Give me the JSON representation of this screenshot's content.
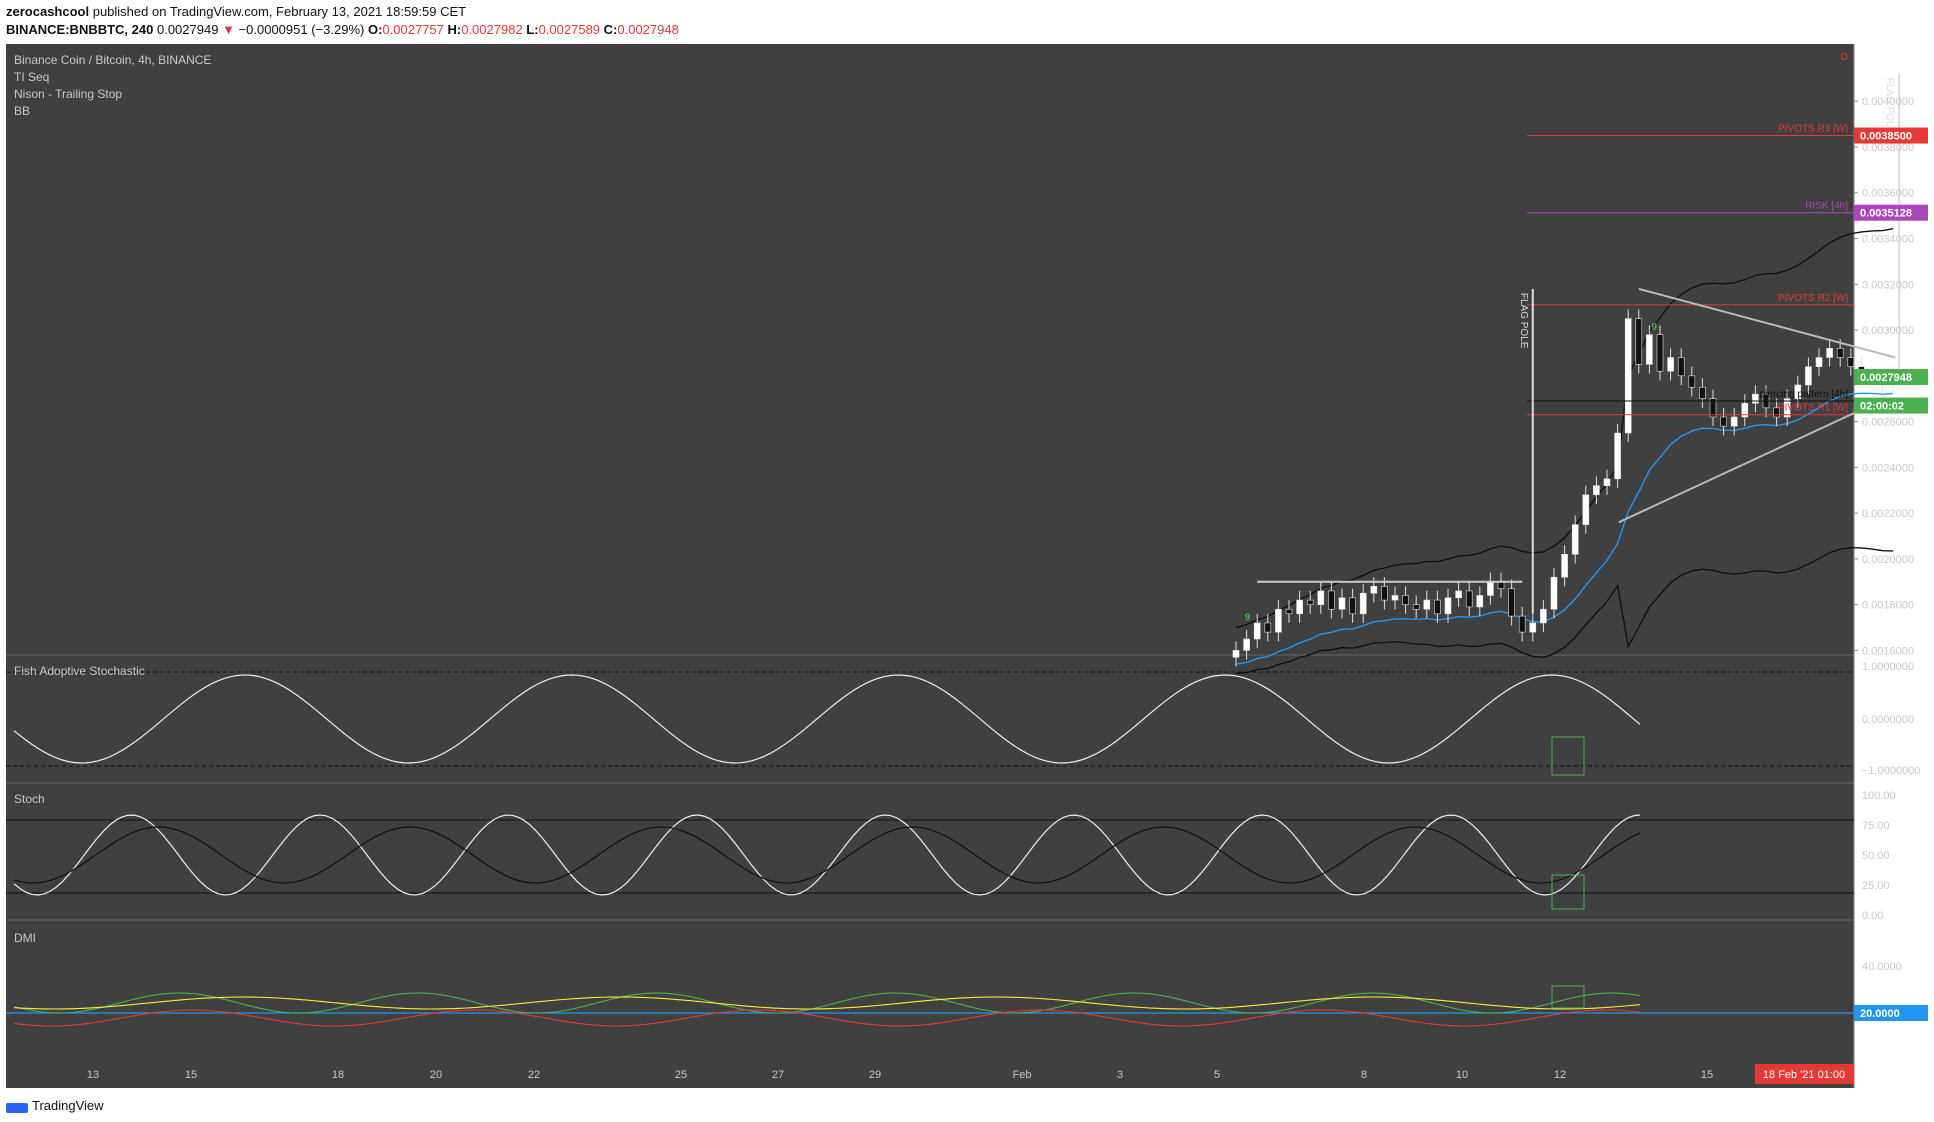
{
  "header": {
    "author": "zerocashcool",
    "published": "published on TradingView.com, February 13, 2021 18:59:59 CET",
    "symbol": "BINANCE:BNBBTC, 240",
    "last": "0.0027949",
    "change_arrow": "▼",
    "change": "−0.0000951 (−3.29%)",
    "o_label": "O:",
    "o": "0.0027757",
    "h_label": "H:",
    "h": "0.0027982",
    "l_label": "L:",
    "l": "0.0027589",
    "c_label": "C:",
    "c": "0.0027948"
  },
  "legend": {
    "title": "Binance Coin / Bitcoin, 4h, BINANCE",
    "items": [
      "TI Seq",
      "Nison - Trailing Stop",
      "BB"
    ]
  },
  "footer": {
    "brand": "TradingView"
  },
  "colors": {
    "bg": "#404040",
    "grid": "#4a4a4a",
    "text": "#c8c8c8",
    "red": "#e53935",
    "purple": "#ab47bc",
    "green": "#4caf50",
    "blue": "#2196f3",
    "yellow": "#ffeb3b",
    "white": "#ffffff"
  },
  "chart_data": {
    "type": "candlestick",
    "price_axis": {
      "min": 0.00158,
      "max": 0.00425,
      "ticks": [
        "0.0016000",
        "0.0018000",
        "0.0020000",
        "0.0022000",
        "0.0024000",
        "0.0026000",
        "0.0028000",
        "0.0030000",
        "0.0032000",
        "0.0034000",
        "0.0036000",
        "0.0038000",
        "0.0040000"
      ]
    },
    "x_axis": {
      "ticks": [
        "13",
        "15",
        "18",
        "20",
        "22",
        "25",
        "27",
        "29",
        "Feb",
        "3",
        "5",
        "8",
        "10",
        "12",
        "15"
      ],
      "current_label": "18 Feb '21  01:00"
    },
    "price_labels": [
      {
        "text": "0.0038500",
        "value": 0.00385,
        "color": "#e53935"
      },
      {
        "text": "0.0035128",
        "value": 0.0035128,
        "color": "#ab47bc"
      },
      {
        "text": "0.0027948",
        "value": 0.0027948,
        "color": "#4caf50"
      },
      {
        "text": "02:00:02",
        "value": 0.00267,
        "color": "#4caf50"
      }
    ],
    "levels": [
      {
        "label": "PIVOTS R3 [W]",
        "value": 0.00385,
        "color": "#e53935"
      },
      {
        "label": "RISK [4h]",
        "value": 0.0035128,
        "color": "#ab47bc"
      },
      {
        "label": "PIVOTS R2 [W]",
        "value": 0.00311,
        "color": "#e53935"
      },
      {
        "label": "piercing pattern [4h]",
        "value": 0.00269,
        "color": "#000000"
      },
      {
        "label": "PIVOTS R1 [W]",
        "value": 0.00263,
        "color": "#e53935"
      }
    ],
    "annotations": [
      "FLAG POLE",
      "FLAG POLE",
      "D",
      "9",
      "9"
    ],
    "candles_recent": {
      "period": "Feb 5 – Feb 13",
      "closes": [
        0.0016,
        0.00165,
        0.00172,
        0.00168,
        0.00178,
        0.00176,
        0.00182,
        0.0018,
        0.00186,
        0.00178,
        0.00183,
        0.00176,
        0.00185,
        0.00188,
        0.00182,
        0.00184,
        0.0018,
        0.00178,
        0.00182,
        0.00176,
        0.00183,
        0.00186,
        0.00179,
        0.00184,
        0.0019,
        0.00187,
        0.00175,
        0.00168,
        0.00172,
        0.00178,
        0.00192,
        0.00202,
        0.00215,
        0.00228,
        0.00232,
        0.00235,
        0.00255,
        0.00305,
        0.00285,
        0.00298,
        0.00282,
        0.00288,
        0.0028,
        0.00275,
        0.0027,
        0.00262,
        0.00258,
        0.00262,
        0.00268,
        0.00272,
        0.00266,
        0.00262,
        0.0027,
        0.00276,
        0.00284,
        0.00288,
        0.00292,
        0.00288,
        0.00284,
        0.0028,
        0.00278,
        0.00276,
        0.0028
      ]
    },
    "panels": [
      {
        "name": "Fish Adoptive Stochastic",
        "ticks": [
          "1.0000000",
          "0.0000000",
          "−1.0000000"
        ]
      },
      {
        "name": "Stoch",
        "ticks": [
          "100.00",
          "75.00",
          "50.00",
          "25.00",
          "0.00"
        ]
      },
      {
        "name": "DMI",
        "ticks": [
          "40.0000",
          "20.0000"
        ]
      }
    ]
  }
}
